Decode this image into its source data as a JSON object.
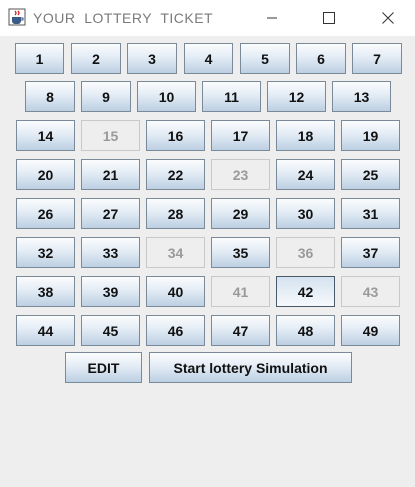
{
  "window": {
    "title": "YOUR  LOTTERY  TICKET",
    "icons": {
      "app": "java-cup-icon",
      "minimize": "minimize-icon",
      "maximize": "maximize-icon",
      "close": "close-icon"
    }
  },
  "numbers": {
    "n1": "1",
    "n2": "2",
    "n3": "3",
    "n4": "4",
    "n5": "5",
    "n6": "6",
    "n7": "7",
    "n8": "8",
    "n9": "9",
    "n10": "10",
    "n11": "11",
    "n12": "12",
    "n13": "13",
    "n14": "14",
    "n15": "15",
    "n16": "16",
    "n17": "17",
    "n18": "18",
    "n19": "19",
    "n20": "20",
    "n21": "21",
    "n22": "22",
    "n23": "23",
    "n24": "24",
    "n25": "25",
    "n26": "26",
    "n27": "27",
    "n28": "28",
    "n29": "29",
    "n30": "30",
    "n31": "31",
    "n32": "32",
    "n33": "33",
    "n34": "34",
    "n35": "35",
    "n36": "36",
    "n37": "37",
    "n38": "38",
    "n39": "39",
    "n40": "40",
    "n41": "41",
    "n42": "42",
    "n43": "43",
    "n44": "44",
    "n45": "45",
    "n46": "46",
    "n47": "47",
    "n48": "48",
    "n49": "49"
  },
  "picked_numbers": [
    "15",
    "23",
    "34",
    "36",
    "41",
    "43"
  ],
  "focused_number": "42",
  "actions": {
    "edit_label": "EDIT",
    "start_label": "Start lottery Simulation"
  },
  "colors": {
    "window_bg": "#eeeeee",
    "button_top": "#fbfcfd",
    "button_bottom": "#bccfe2",
    "disabled_text": "#9a9a9a"
  }
}
